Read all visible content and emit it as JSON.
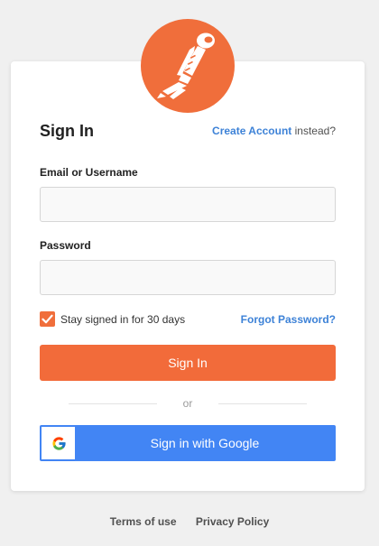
{
  "brand": {
    "logo_icon": "postman-astronaut-icon",
    "accent_color": "#f06e3b"
  },
  "signin": {
    "title": "Sign In",
    "create_account_link": "Create Account",
    "create_account_suffix": " instead?"
  },
  "email": {
    "label": "Email or Username",
    "value": "",
    "placeholder": ""
  },
  "password": {
    "label": "Password",
    "value": "",
    "placeholder": ""
  },
  "remember": {
    "label": "Stay signed in for 30 days",
    "checked": true
  },
  "forgot_password": "Forgot Password?",
  "sign_in_button": "Sign In",
  "divider_text": "or",
  "google": {
    "label": "Sign in with Google",
    "icon": "google-icon",
    "color": "#4285f4"
  },
  "footer": {
    "terms": "Terms of use",
    "privacy": "Privacy Policy"
  }
}
